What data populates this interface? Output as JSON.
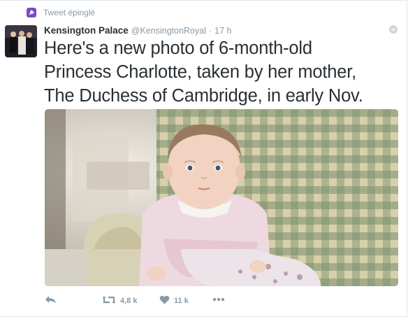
{
  "pinned": {
    "label": "Tweet épinglé"
  },
  "author": {
    "name": "Kensington Palace",
    "handle": "@KensingtonRoyal",
    "separator": "·",
    "time": "17 h"
  },
  "tweet": {
    "lines": [
      "Here's a new photo of 6-month-old",
      "Princess Charlotte, taken by her mother,",
      "The Duchess of Cambridge, in early Nov."
    ]
  },
  "actions": {
    "retweets": "4,8 k",
    "likes": "11 k"
  },
  "colors": {
    "text": "#292f33",
    "muted": "#8899a6",
    "pin_badge": "#794bc4",
    "border": "#e1e8ed"
  },
  "icons": [
    "pin-icon",
    "caret-icon",
    "reply-icon",
    "retweet-icon",
    "heart-icon",
    "more-icon"
  ]
}
